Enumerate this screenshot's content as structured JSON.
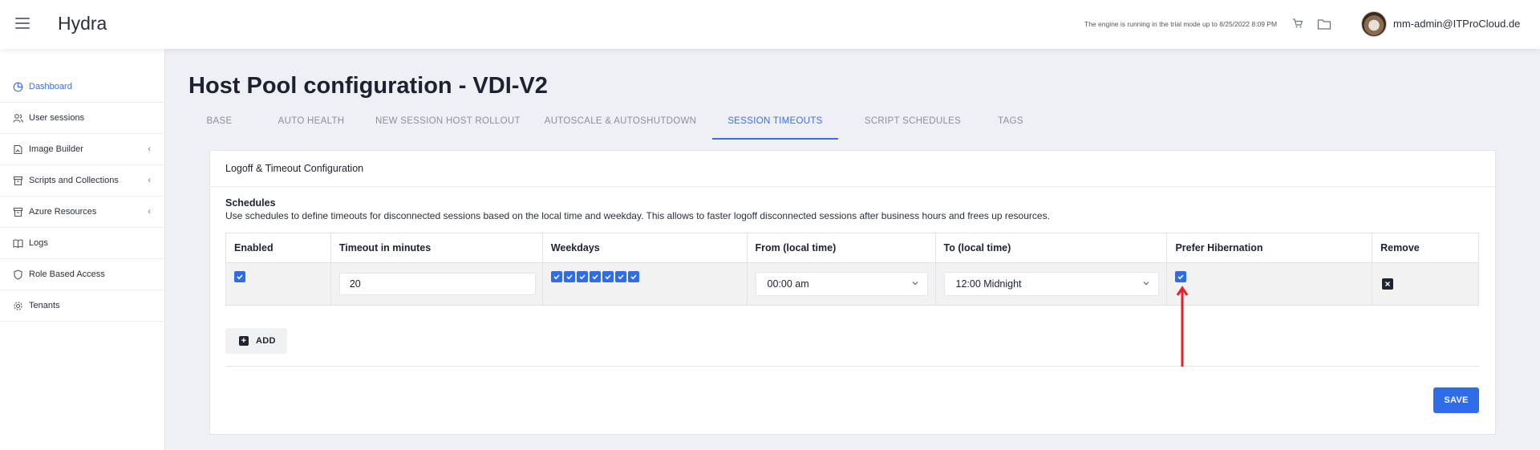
{
  "header": {
    "app_title": "Hydra",
    "trial_notice": "The engine is running in the trial mode up to 8/25/2022 8:09 PM",
    "user_email": "mm-admin@ITProCloud.de"
  },
  "sidebar": {
    "items": [
      {
        "label": "Dashboard",
        "icon": "dashboard-icon",
        "active": true
      },
      {
        "label": "User sessions",
        "icon": "users-icon"
      },
      {
        "label": "Image Builder",
        "icon": "image-icon",
        "has_children": true
      },
      {
        "label": "Scripts and Collections",
        "icon": "archive-icon",
        "has_children": true
      },
      {
        "label": "Azure Resources",
        "icon": "archive-icon",
        "has_children": true
      },
      {
        "label": "Logs",
        "icon": "book-icon"
      },
      {
        "label": "Role Based Access",
        "icon": "shield-icon"
      },
      {
        "label": "Tenants",
        "icon": "gear-icon"
      }
    ],
    "chevron": "‹"
  },
  "page": {
    "title": "Host Pool configuration - VDI-V2"
  },
  "tabs": [
    {
      "label": "BASE"
    },
    {
      "label": "AUTO HEALTH"
    },
    {
      "label": "NEW SESSION HOST ROLLOUT"
    },
    {
      "label": "AUTOSCALE & AUTOSHUTDOWN"
    },
    {
      "label": "SESSION TIMEOUTS",
      "active": true
    },
    {
      "label": "SCRIPT SCHEDULES"
    },
    {
      "label": "TAGS"
    }
  ],
  "card": {
    "title": "Logoff & Timeout Configuration",
    "schedules_title": "Schedules",
    "schedules_desc": "Use schedules to define timeouts for disconnected sessions based on the local time and weekday. This allows to faster logoff disconnected sessions after business hours and frees up resources."
  },
  "table": {
    "columns": [
      "Enabled",
      "Timeout in minutes",
      "Weekdays",
      "From (local time)",
      "To (local time)",
      "Prefer Hibernation",
      "Remove"
    ],
    "rows": [
      {
        "enabled": true,
        "timeout": "20",
        "weekdays_checked": 7,
        "from": "00:00 am",
        "to": "12:00 Midnight",
        "prefer_hibernation": true
      }
    ]
  },
  "actions": {
    "add_label": "ADD",
    "save_label": "SAVE"
  },
  "colors": {
    "accent": "#2f6de8",
    "annotation_arrow": "#e8202a"
  }
}
